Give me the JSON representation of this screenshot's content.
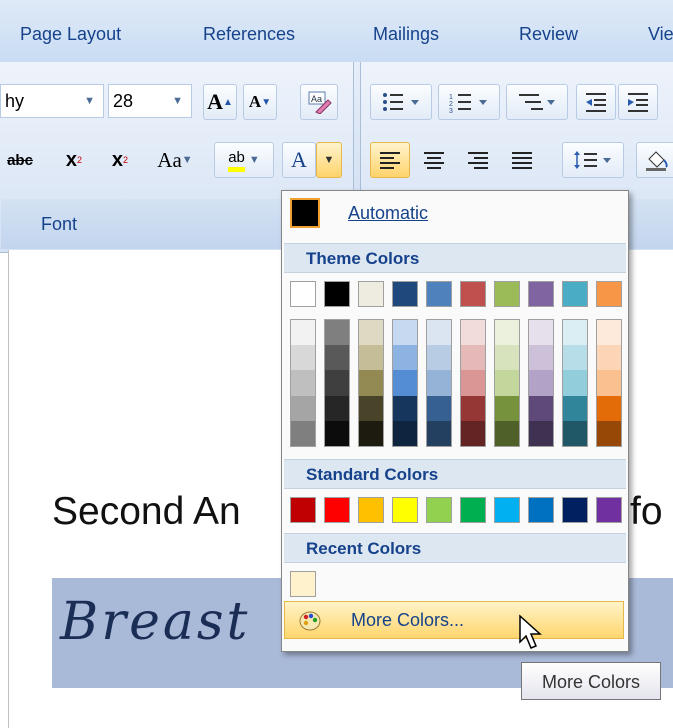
{
  "tabs": [
    "Page Layout",
    "References",
    "Mailings",
    "Review",
    "Vie"
  ],
  "ribbon": {
    "font_name": "hy",
    "font_size": "28",
    "font_group_label": "Font",
    "grow_font_label": "A",
    "shrink_font_label": "A",
    "strikethrough_label": "abc",
    "subscript_label": "x",
    "subscript_mark": "2",
    "superscript_label": "x",
    "superscript_mark": "2",
    "change_case_label": "Aa",
    "highlight_label": "ab",
    "font_color_label": "A"
  },
  "document": {
    "line1_left": "Second An",
    "line1_right": "fo",
    "line2": "Breast"
  },
  "color_menu": {
    "automatic_label": "Automatic",
    "theme_colors_label": "Theme Colors",
    "standard_colors_label": "Standard Colors",
    "recent_colors_label": "Recent Colors",
    "more_colors_label": "More Colors...",
    "theme_top": [
      "#FFFFFF",
      "#000000",
      "#EEECE1",
      "#1F497D",
      "#4F81BD",
      "#C0504D",
      "#9BBB59",
      "#8064A2",
      "#4BACC6",
      "#F79646"
    ],
    "theme_shades": [
      [
        "#F2F2F2",
        "#D8D8D8",
        "#BFBFBF",
        "#A5A5A5",
        "#7F7F7F"
      ],
      [
        "#7F7F7F",
        "#595959",
        "#3F3F3F",
        "#262626",
        "#0C0C0C"
      ],
      [
        "#DDD9C3",
        "#C4BD97",
        "#938953",
        "#494429",
        "#1D1B10"
      ],
      [
        "#C6D9F0",
        "#8DB3E2",
        "#548DD4",
        "#17365D",
        "#0F243E"
      ],
      [
        "#DBE5F1",
        "#B8CCE4",
        "#95B3D7",
        "#366092",
        "#244061"
      ],
      [
        "#F2DCDB",
        "#E5B9B7",
        "#D99694",
        "#953734",
        "#632423"
      ],
      [
        "#EBF1DD",
        "#D7E3BC",
        "#C3D69B",
        "#76923C",
        "#4F6128"
      ],
      [
        "#E5E0EC",
        "#CCC1D9",
        "#B2A2C7",
        "#5F497A",
        "#3F3151"
      ],
      [
        "#DBEEF3",
        "#B7DDE8",
        "#92CDDC",
        "#31859B",
        "#205867"
      ],
      [
        "#FDEADA",
        "#FBD5B5",
        "#FAC08F",
        "#E36C09",
        "#974806"
      ]
    ],
    "standard": [
      "#C00000",
      "#FF0000",
      "#FFC000",
      "#FFFF00",
      "#92D050",
      "#00B050",
      "#00B0F0",
      "#0070C0",
      "#002060",
      "#7030A0"
    ],
    "recent": [
      "#FFF2CC"
    ]
  },
  "tooltip": "More Colors"
}
